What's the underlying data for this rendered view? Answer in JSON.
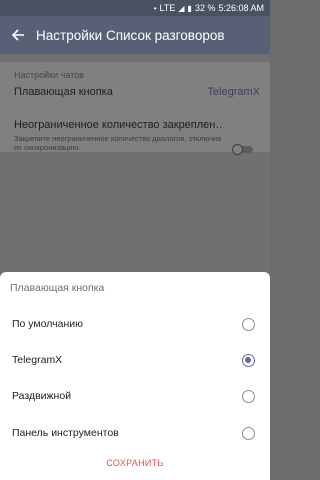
{
  "status_bar": {
    "network": "LTE",
    "battery": "32 %",
    "time": "5:26:08 AM"
  },
  "app_bar": {
    "title": "Настройки Список разговоров"
  },
  "settings": {
    "section_header": "Настройки чатов",
    "floating_button_label": "Плавающая кнопка",
    "floating_button_value": "TelegramX",
    "unlimited_pins_label": "Неограниченное количество закреплен…",
    "unlimited_pins_description": "Закрепите неограниченное количество диалогов, отключив их синхронизацию.",
    "unlimited_pins_enabled": false
  },
  "dialog": {
    "title": "Плавающая кнопка",
    "options": [
      {
        "label": "По умолчанию",
        "selected": false
      },
      {
        "label": "TelegramX",
        "selected": true
      },
      {
        "label": "Раздвижной",
        "selected": false
      },
      {
        "label": "Панель инструментов",
        "selected": false
      }
    ],
    "save_label": "СОХРАНИТЬ"
  },
  "colors": {
    "app_bar": "#596076",
    "status_bar": "#4a5161",
    "radio_accent": "#5a6a9a",
    "save_button": "#e05050"
  },
  "icons": {
    "back": "arrow-left-icon",
    "radio_checked": "radio-checked-icon",
    "radio_unchecked": "radio-unchecked-icon"
  }
}
